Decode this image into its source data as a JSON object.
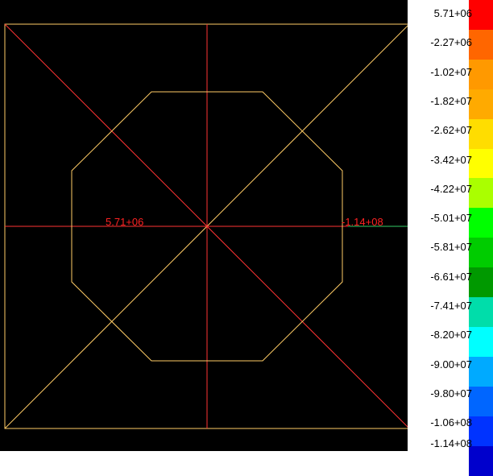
{
  "plot": {
    "min_label": "5.71+06",
    "max_label": "-1.14+08",
    "colors": {
      "background": "#000000",
      "frame": "#ffcc66",
      "diagonal": "#ff3333",
      "octagon": "#ffcc66",
      "axis_label": "#ff2222",
      "axis_stub_right": "#33cc66"
    }
  },
  "legend": {
    "ticks": [
      "5.71+06",
      "-2.27+06",
      "-1.02+07",
      "-1.82+07",
      "-2.62+07",
      "-3.42+07",
      "-4.22+07",
      "-5.01+07",
      "-5.81+07",
      "-6.61+07",
      "-7.41+07",
      "-8.20+07",
      "-9.00+07",
      "-9.80+07",
      "-1.06+08",
      "-1.14+08"
    ],
    "colors": [
      "#ff0000",
      "#ff6600",
      "#ff9900",
      "#ffaa00",
      "#ffdd00",
      "#ffff00",
      "#aaff00",
      "#00ff00",
      "#00cc00",
      "#009900",
      "#00ddaa",
      "#00ffff",
      "#00aaff",
      "#0066ff",
      "#0033ff",
      "#0000cc"
    ]
  }
}
